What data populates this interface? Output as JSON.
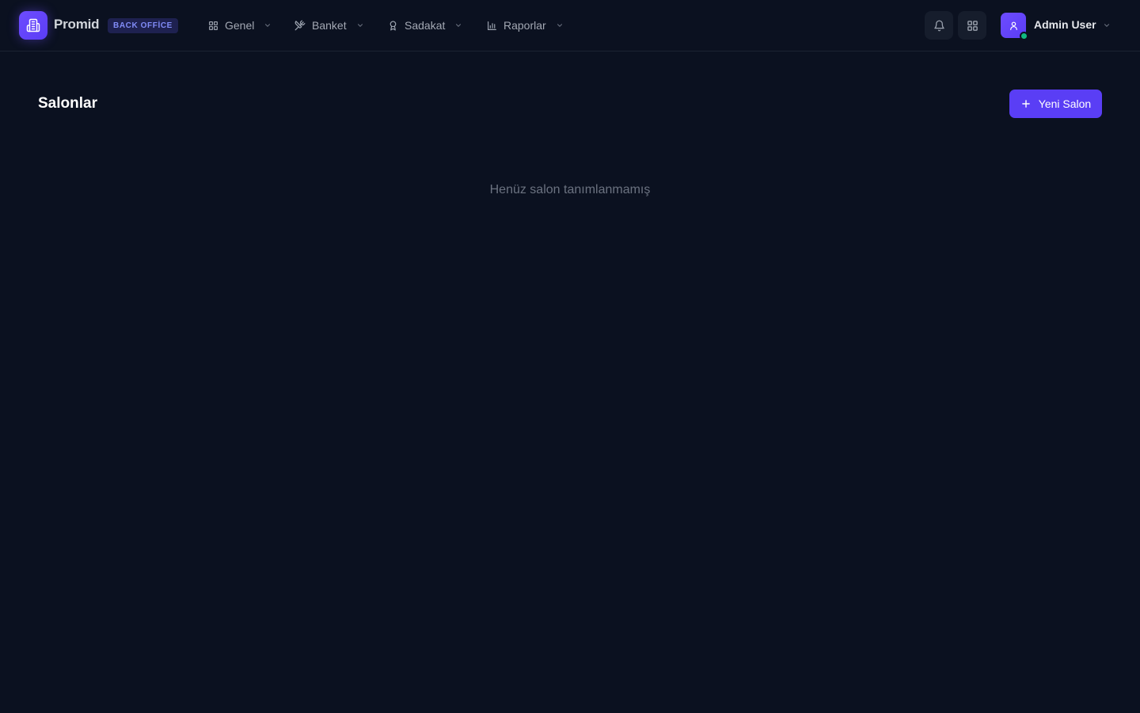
{
  "brand": {
    "name": "Promid",
    "badge": "BACK OFFİCE"
  },
  "nav": {
    "items": [
      {
        "label": "Genel",
        "icon": "grid-icon"
      },
      {
        "label": "Banket",
        "icon": "utensils-icon"
      },
      {
        "label": "Sadakat",
        "icon": "award-icon"
      },
      {
        "label": "Raporlar",
        "icon": "bar-chart-icon"
      }
    ]
  },
  "header_actions": {
    "notifications_icon": "bell-icon",
    "apps_icon": "apps-grid-icon"
  },
  "user": {
    "name": "Admin User",
    "status": "online"
  },
  "page": {
    "title": "Salonlar",
    "new_button_label": "Yeni Salon",
    "empty_message": "Henüz salon tanımlanmamış"
  },
  "colors": {
    "background": "#0b1120",
    "accent": "#5a3ef5",
    "badge_text": "#818cf8",
    "online": "#10b981"
  }
}
